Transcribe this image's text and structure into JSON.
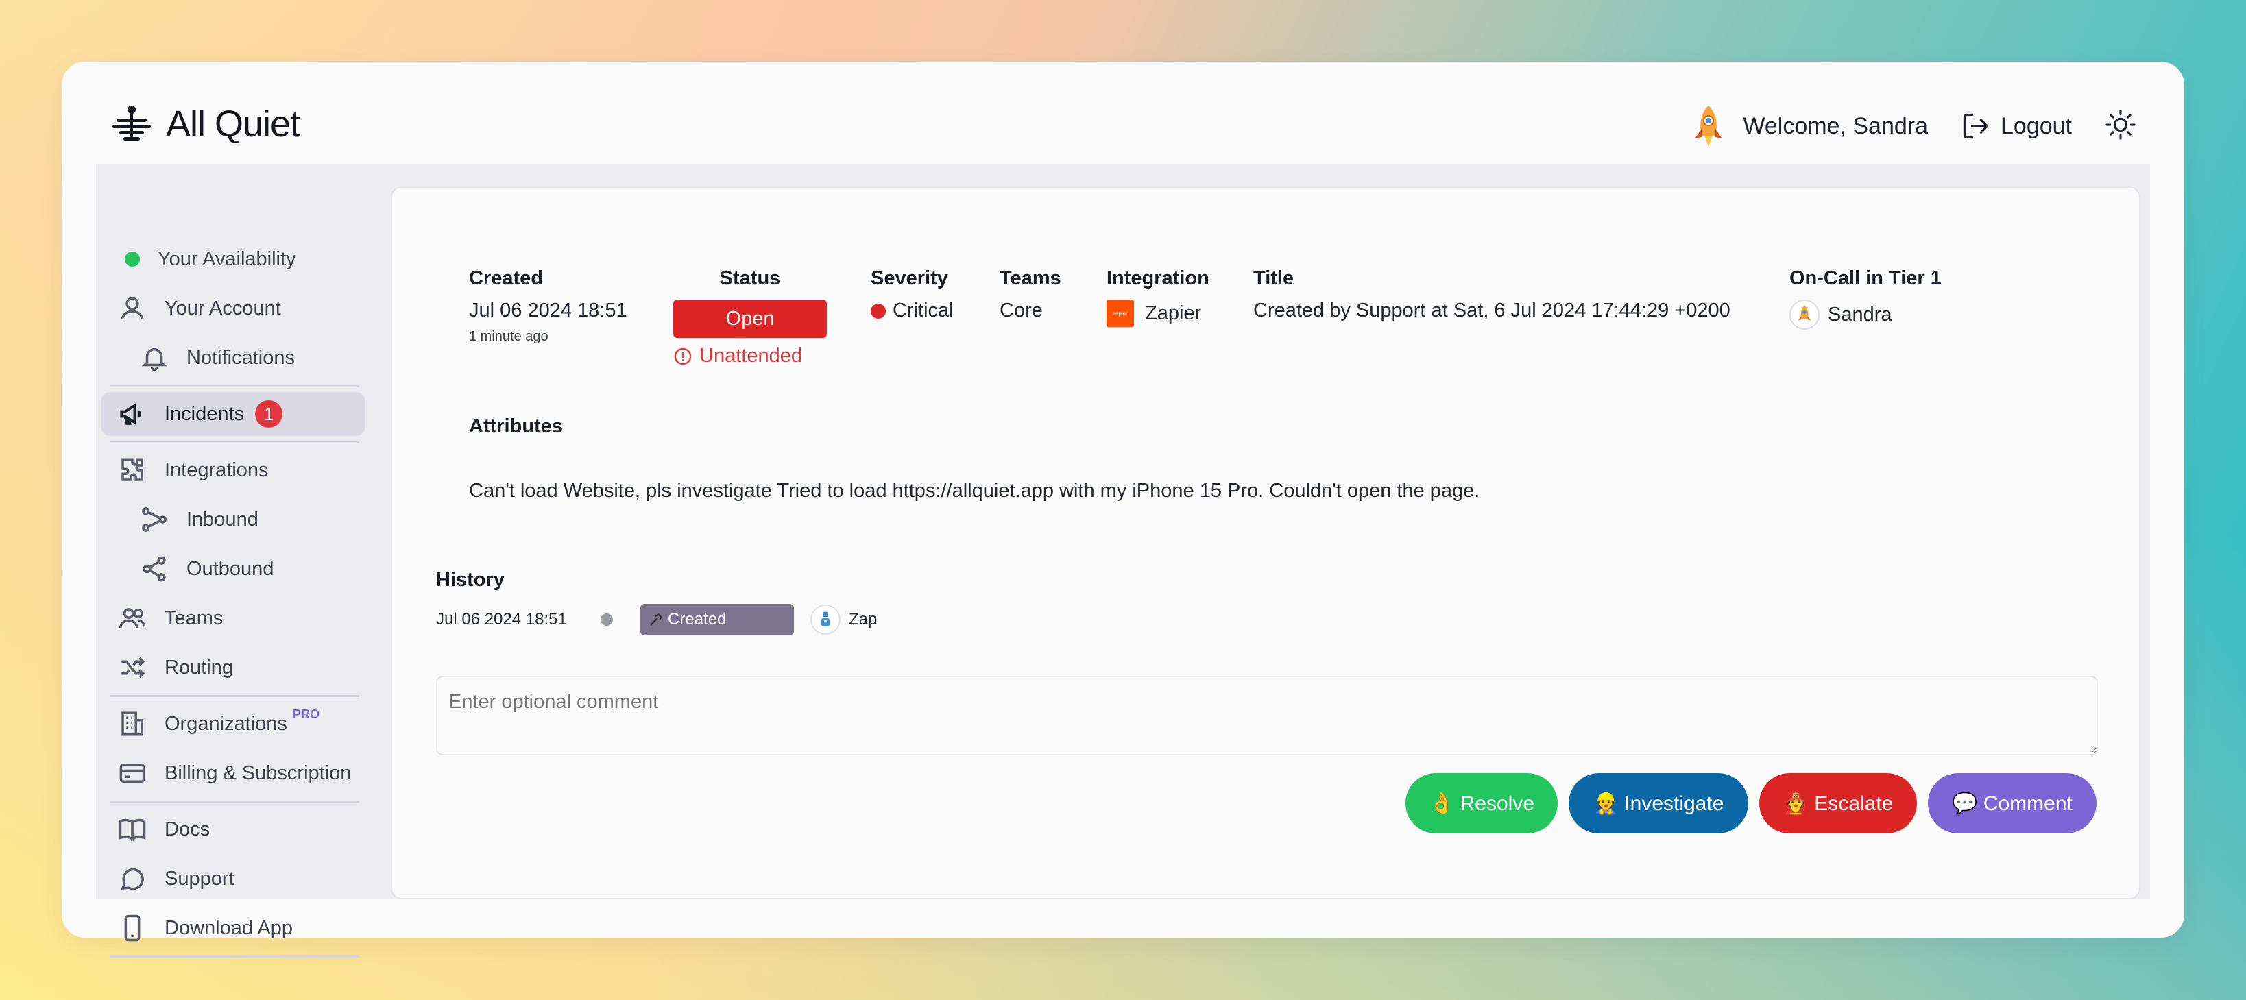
{
  "app": {
    "name": "All Quiet"
  },
  "header": {
    "welcome": "Welcome, Sandra",
    "logout_label": "Logout"
  },
  "sidebar": {
    "availability": "Your Availability",
    "account": "Your Account",
    "notifications": "Notifications",
    "incidents": "Incidents",
    "incidents_badge": "1",
    "integrations": "Integrations",
    "inbound": "Inbound",
    "outbound": "Outbound",
    "teams": "Teams",
    "routing": "Routing",
    "organizations": "Organizations",
    "organizations_tag": "PRO",
    "billing": "Billing & Subscription",
    "docs": "Docs",
    "support": "Support",
    "download": "Download App"
  },
  "incident": {
    "created_label": "Created",
    "created_value": "Jul 06 2024 18:51",
    "created_ago": "1 minute ago",
    "status_label": "Status",
    "status_value": "Open",
    "status_sub": "Unattended",
    "severity_label": "Severity",
    "severity_value": "Critical",
    "teams_label": "Teams",
    "teams_value": "Core",
    "integration_label": "Integration",
    "integration_value": "Zapier",
    "integration_icon_text": "zapier",
    "title_label": "Title",
    "title_value": "Created by Support at Sat, 6 Jul 2024 17:44:29 +0200",
    "oncall_label": "On-Call in Tier 1",
    "oncall_value": "Sandra",
    "attributes_label": "Attributes",
    "description": "Can't load Website, pls investigate Tried to load https://allquiet.app with my iPhone 15 Pro. Couldn't open the page."
  },
  "history": {
    "label": "History",
    "items": [
      {
        "date": "Jul 06 2024 18:51",
        "event": "Created",
        "actor": "Zap"
      }
    ]
  },
  "comment": {
    "placeholder": "Enter optional comment"
  },
  "actions": {
    "resolve": "👌 Resolve",
    "investigate": "👷 Investigate",
    "escalate": "🧑‍🚒 Escalate",
    "comment": "💬 Comment"
  },
  "colors": {
    "status_open": "#dc2626",
    "resolve": "#22c55e",
    "investigate": "#0b67a6",
    "escalate": "#dc2626",
    "comment": "#7c66d6",
    "availability": "#24c35a"
  }
}
